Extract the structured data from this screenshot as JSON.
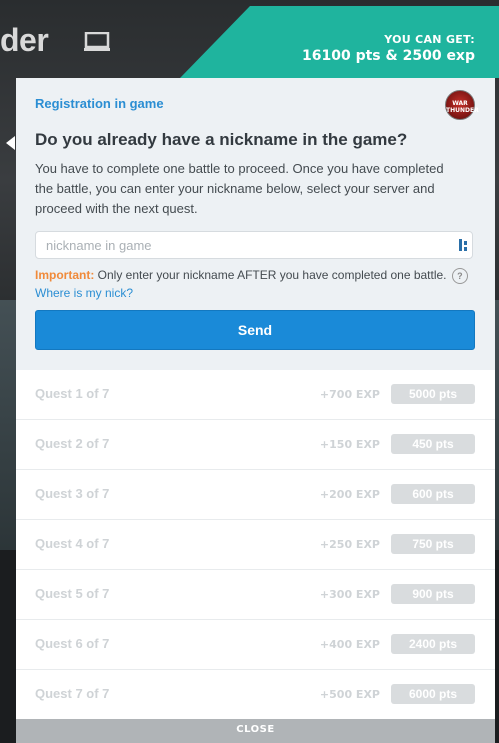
{
  "background": {
    "title": "der"
  },
  "reward": {
    "label": "YOU CAN GET:",
    "value": "16100 pts & 2500 exp"
  },
  "registration": {
    "title": "Registration in game",
    "logo_alt": "WAR THUNDER",
    "question": "Do you already have a nickname in the game?",
    "description": "You have to complete one battle to proceed. Once you have completed the battle, you can enter your nickname below, select your server and proceed with the next quest.",
    "input_placeholder": "nickname in game",
    "important_label": "Important:",
    "important_text": " Only enter your nickname AFTER you have completed one battle.",
    "help_glyph": "?",
    "where_link": "Where is my nick?",
    "send_label": "Send"
  },
  "quests": [
    {
      "name": "Quest 1 of 7",
      "exp": "+700 EXP",
      "pts": "5000 pts"
    },
    {
      "name": "Quest 2 of 7",
      "exp": "+150 EXP",
      "pts": "450 pts"
    },
    {
      "name": "Quest 3 of 7",
      "exp": "+200 EXP",
      "pts": "600 pts"
    },
    {
      "name": "Quest 4 of 7",
      "exp": "+250 EXP",
      "pts": "750 pts"
    },
    {
      "name": "Quest 5 of 7",
      "exp": "+300 EXP",
      "pts": "900 pts"
    },
    {
      "name": "Quest 6 of 7",
      "exp": "+400 EXP",
      "pts": "2400 pts"
    },
    {
      "name": "Quest 7 of 7",
      "exp": "+500 EXP",
      "pts": "6000 pts"
    }
  ],
  "close_label": "CLOSE",
  "colors": {
    "accent_teal": "#1fb49e",
    "link_blue": "#2b8ed3",
    "button_blue": "#1a8ad8",
    "important_orange": "#f08a3a"
  }
}
